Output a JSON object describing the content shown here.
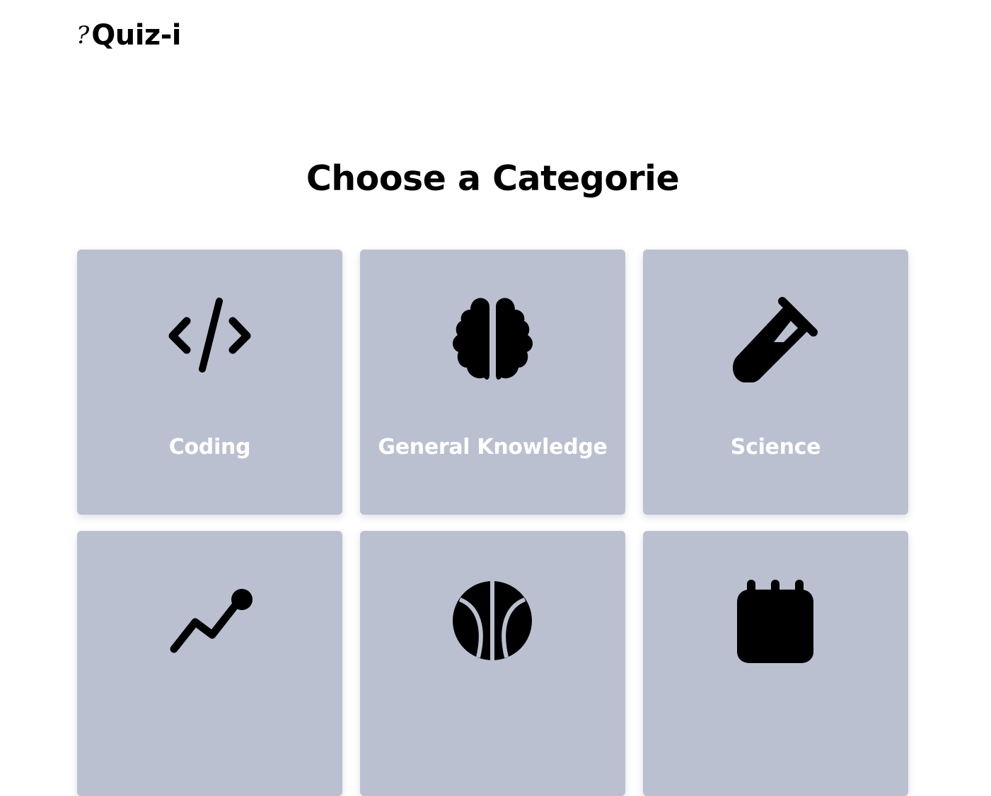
{
  "header": {
    "logo_mark": "?",
    "logo_text": "Quiz-i"
  },
  "page": {
    "title": "Choose a Categorie"
  },
  "categories": [
    {
      "label": "Coding",
      "icon": "code-icon"
    },
    {
      "label": "General Knowledge",
      "icon": "brain-icon"
    },
    {
      "label": "Science",
      "icon": "flask-icon"
    },
    {
      "label": "",
      "icon": "chart-icon"
    },
    {
      "label": "",
      "icon": "basketball-icon"
    },
    {
      "label": "",
      "icon": "calendar-icon"
    }
  ],
  "colors": {
    "card_background": "#bbc0d0",
    "card_text": "#ffffff",
    "text": "#000000",
    "background": "#ffffff"
  }
}
